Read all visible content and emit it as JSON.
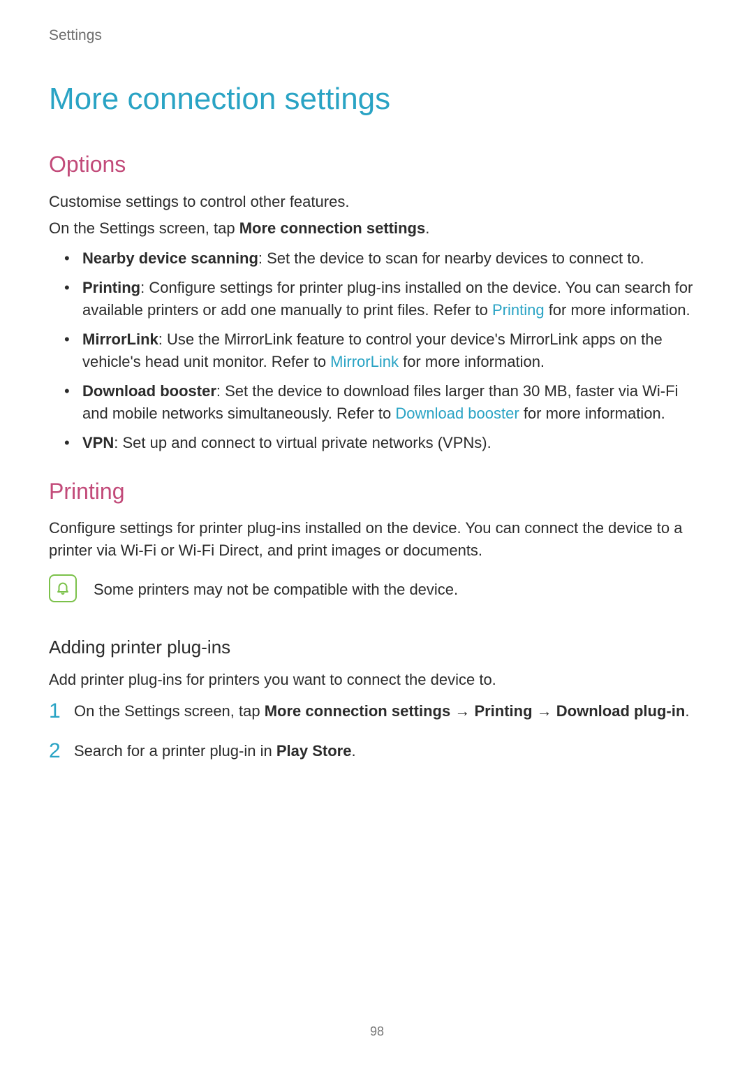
{
  "breadcrumb": "Settings",
  "title": "More connection settings",
  "options": {
    "heading": "Options",
    "intro1": "Customise settings to control other features.",
    "intro2_pre": "On the Settings screen, tap ",
    "intro2_strong": "More connection settings",
    "intro2_post": ".",
    "items": [
      {
        "name": "Nearby device scanning",
        "text": ": Set the device to scan for nearby devices to connect to."
      },
      {
        "name": "Printing",
        "text_pre": ": Configure settings for printer plug-ins installed on the device. You can search for available printers or add one manually to print files. Refer to ",
        "link": "Printing",
        "text_post": " for more information."
      },
      {
        "name": "MirrorLink",
        "text_pre": ": Use the MirrorLink feature to control your device's MirrorLink apps on the vehicle's head unit monitor. Refer to ",
        "link": "MirrorLink",
        "text_post": " for more information."
      },
      {
        "name": "Download booster",
        "text_pre": ": Set the device to download files larger than 30 MB, faster via Wi-Fi and mobile networks simultaneously. Refer to ",
        "link": "Download booster",
        "text_post": " for more information."
      },
      {
        "name": "VPN",
        "text": ": Set up and connect to virtual private networks (VPNs)."
      }
    ]
  },
  "printing": {
    "heading": "Printing",
    "intro": "Configure settings for printer plug-ins installed on the device. You can connect the device to a printer via Wi-Fi or Wi-Fi Direct, and print images or documents.",
    "note": "Some printers may not be compatible with the device.",
    "subheading": "Adding printer plug-ins",
    "subintro": "Add printer plug-ins for printers you want to connect the device to.",
    "steps": [
      {
        "num": "1",
        "pre": "On the Settings screen, tap ",
        "s1": "More connection settings",
        "arrow1": " → ",
        "s2": "Printing",
        "arrow2": " → ",
        "s3": "Download plug-in",
        "post": "."
      },
      {
        "num": "2",
        "pre": "Search for a printer plug-in in ",
        "s1": "Play Store",
        "post": "."
      }
    ]
  },
  "page_number": "98"
}
